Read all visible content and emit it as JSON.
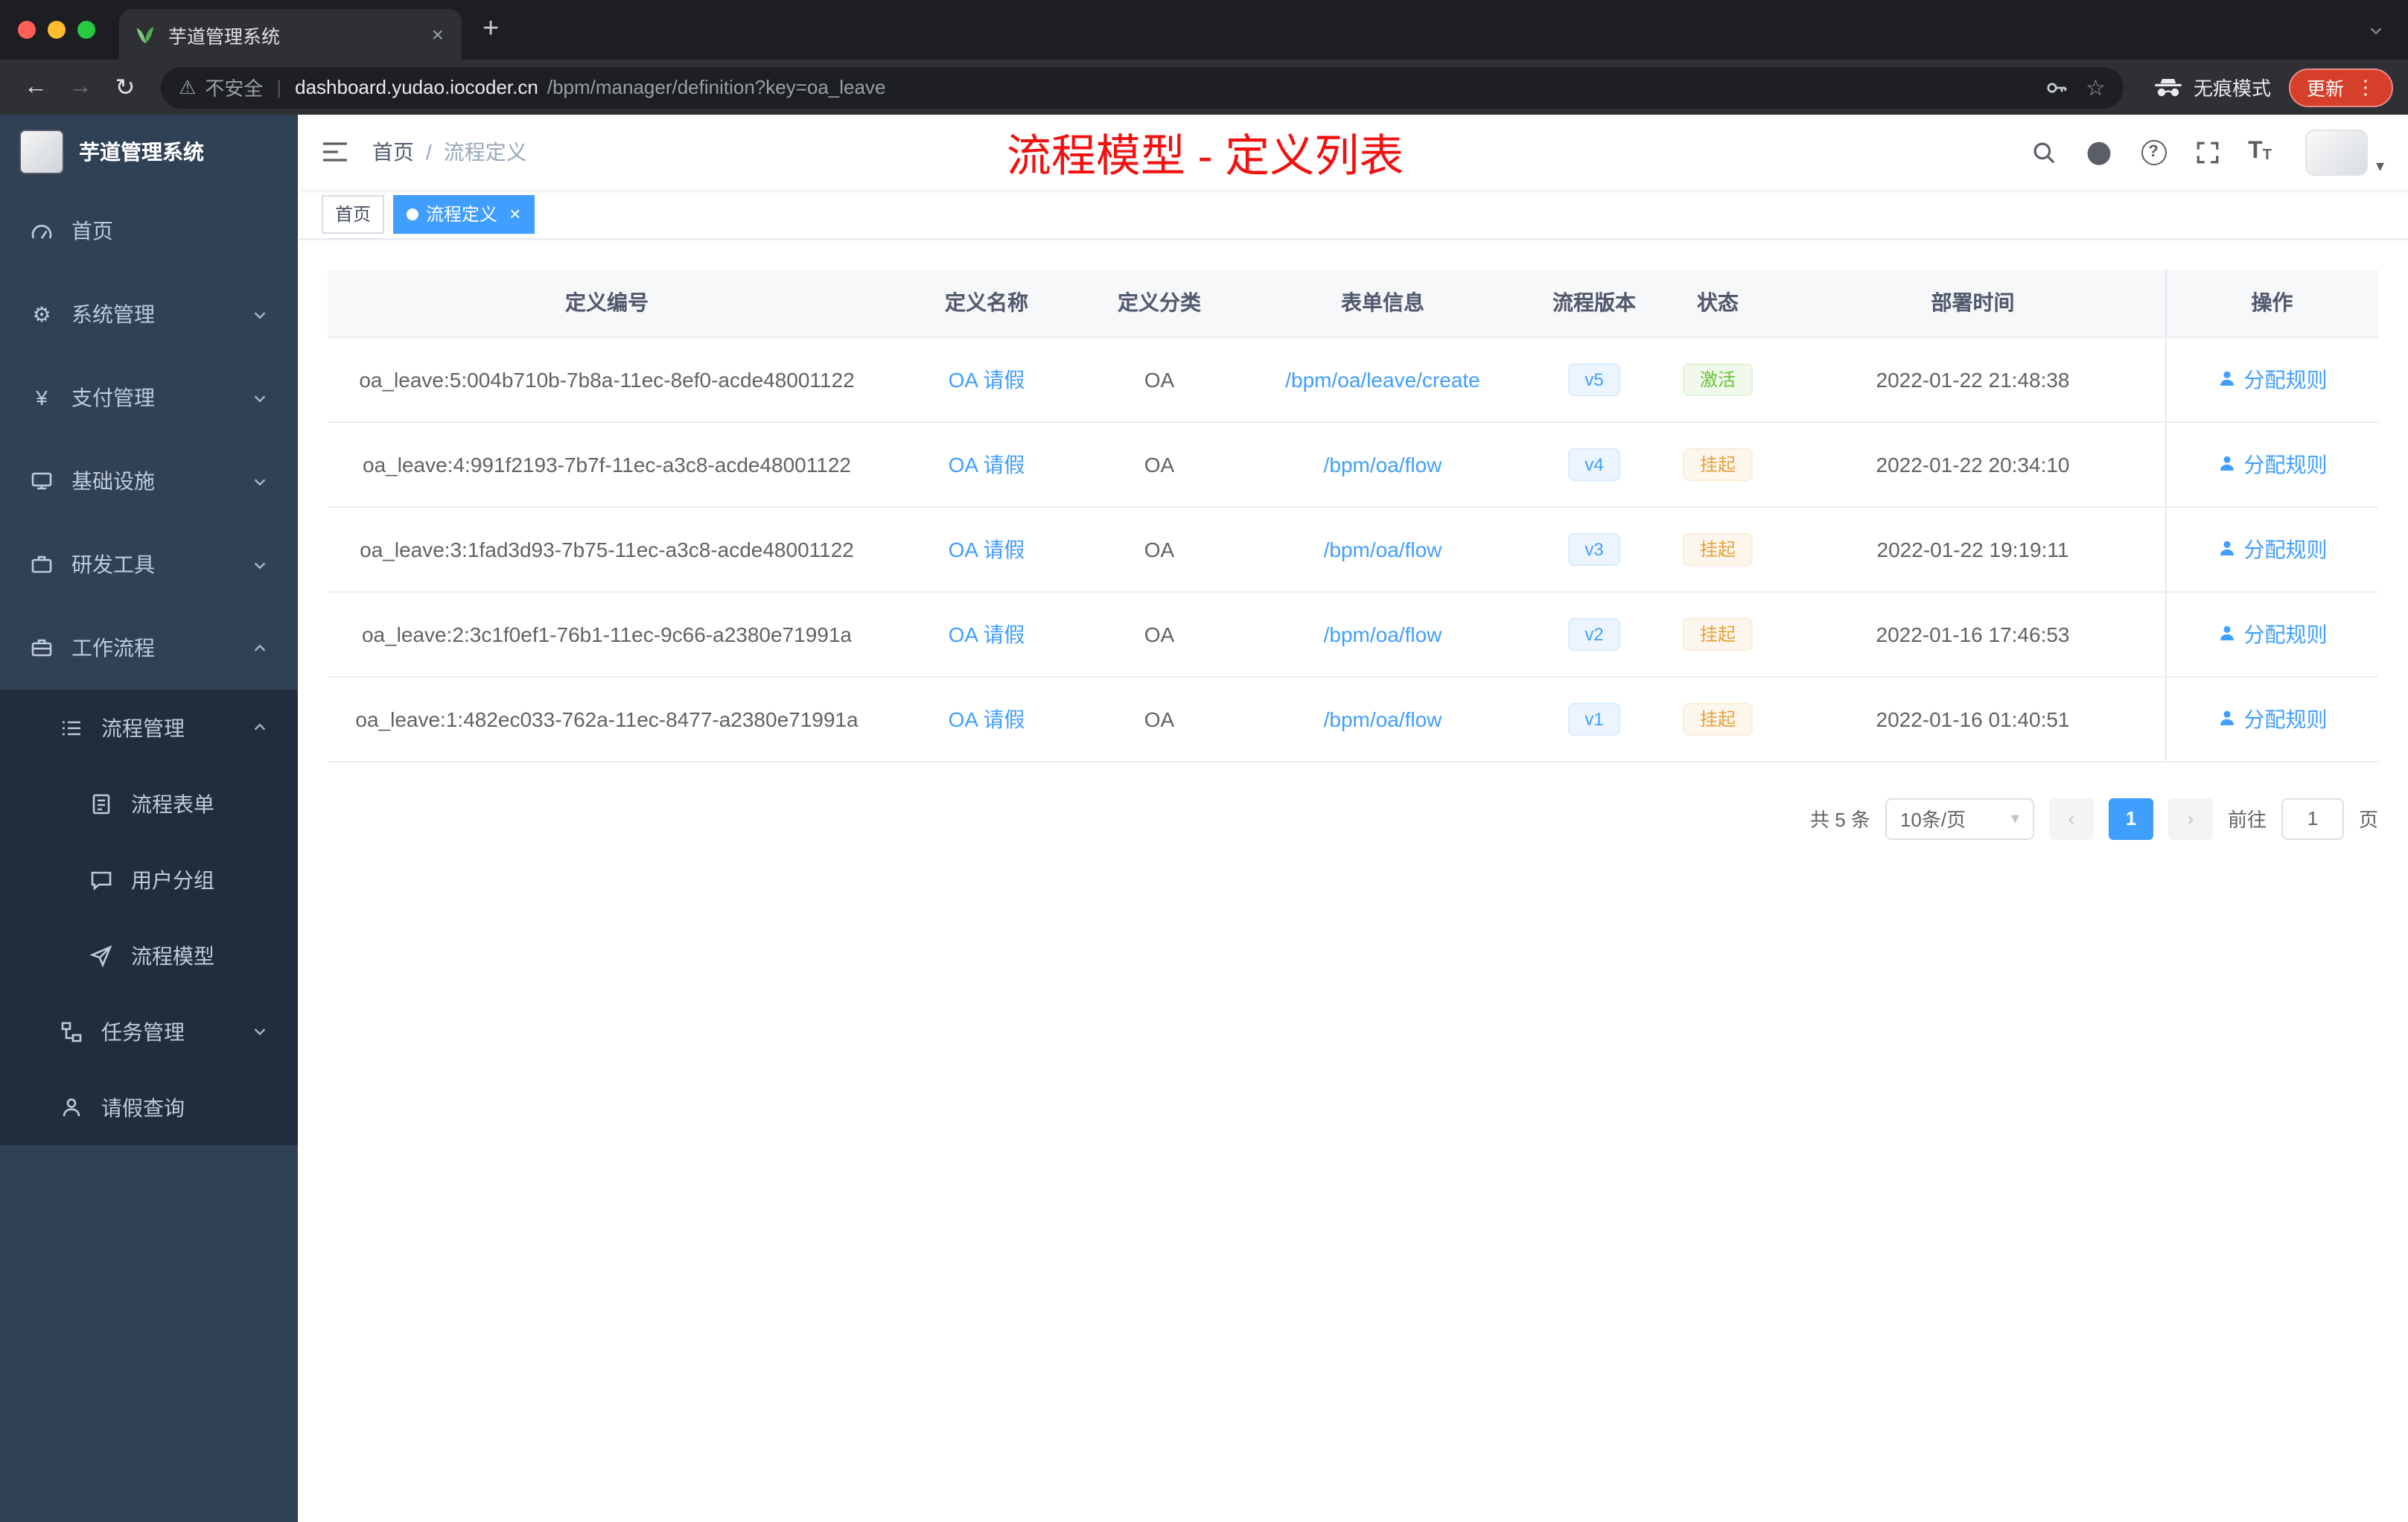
{
  "colors": {
    "accent_blue": "#409eff",
    "status_active_green": "#67c23a",
    "status_suspended_yellow": "#e6a23c",
    "annotation_red": "#f21111",
    "sidebar_bg": "#304156",
    "sidebar_submenu_bg": "#1f2d3d",
    "traffic_red": "#ff5f57",
    "traffic_yellow": "#febc2e",
    "traffic_green": "#28c840"
  },
  "icons": {
    "back": "←",
    "forward": "→",
    "reload": "↻",
    "warning": "⚠",
    "star": "☆",
    "more": "⋮",
    "close": "×",
    "new_tab": "+",
    "gear": "⚙",
    "yen": "¥",
    "caret_down": "▾",
    "question": "?",
    "divider": "|",
    "prev": "‹",
    "next": "›",
    "font_size_large": "T",
    "font_size_small": "T"
  },
  "browser": {
    "tab_title": "芋道管理系统",
    "security_label": "不安全",
    "url_host": "dashboard.yudao.iocoder.cn",
    "url_path": "/bpm/manager/definition?key=oa_leave",
    "incognito_label": "无痕模式",
    "update_label": "更新"
  },
  "sidebar": {
    "logo_title": "芋道管理系统",
    "items": [
      {
        "label": "首页"
      },
      {
        "label": "系统管理"
      },
      {
        "label": "支付管理"
      },
      {
        "label": "基础设施"
      },
      {
        "label": "研发工具"
      },
      {
        "label": "工作流程"
      }
    ],
    "workflow": {
      "process_mgmt": {
        "label": "流程管理",
        "children": [
          {
            "label": "流程表单"
          },
          {
            "label": "用户分组"
          },
          {
            "label": "流程模型"
          }
        ]
      },
      "task_mgmt": {
        "label": "任务管理"
      },
      "leave_query": {
        "label": "请假查询"
      }
    }
  },
  "header": {
    "breadcrumb": {
      "home": "首页",
      "separator": "/",
      "current": "流程定义"
    },
    "annotation": "流程模型 - 定义列表"
  },
  "tags": {
    "home": "首页",
    "active": "流程定义"
  },
  "table": {
    "columns": [
      "定义编号",
      "定义名称",
      "定义分类",
      "表单信息",
      "流程版本",
      "状态",
      "部署时间",
      "操作"
    ],
    "rows": [
      {
        "id": "oa_leave:5:004b710b-7b8a-11ec-8ef0-acde48001122",
        "name": "OA 请假",
        "category": "OA",
        "form": "/bpm/oa/leave/create",
        "version": "v5",
        "status": "激活",
        "deploy_time": "2022-01-22 21:48:38",
        "action": "分配规则"
      },
      {
        "id": "oa_leave:4:991f2193-7b7f-11ec-a3c8-acde48001122",
        "name": "OA 请假",
        "category": "OA",
        "form": "/bpm/oa/flow",
        "version": "v4",
        "status": "挂起",
        "deploy_time": "2022-01-22 20:34:10",
        "action": "分配规则"
      },
      {
        "id": "oa_leave:3:1fad3d93-7b75-11ec-a3c8-acde48001122",
        "name": "OA 请假",
        "category": "OA",
        "form": "/bpm/oa/flow",
        "version": "v3",
        "status": "挂起",
        "deploy_time": "2022-01-22 19:19:11",
        "action": "分配规则"
      },
      {
        "id": "oa_leave:2:3c1f0ef1-76b1-11ec-9c66-a2380e71991a",
        "name": "OA 请假",
        "category": "OA",
        "form": "/bpm/oa/flow",
        "version": "v2",
        "status": "挂起",
        "deploy_time": "2022-01-16 17:46:53",
        "action": "分配规则"
      },
      {
        "id": "oa_leave:1:482ec033-762a-11ec-8477-a2380e71991a",
        "name": "OA 请假",
        "category": "OA",
        "form": "/bpm/oa/flow",
        "version": "v1",
        "status": "挂起",
        "deploy_time": "2022-01-16 01:40:51",
        "action": "分配规则"
      }
    ]
  },
  "pagination": {
    "total": "共 5 条",
    "page_size": "10条/页",
    "current_page": "1",
    "goto_label": "前往",
    "goto_value": "1",
    "unit_label": "页"
  }
}
